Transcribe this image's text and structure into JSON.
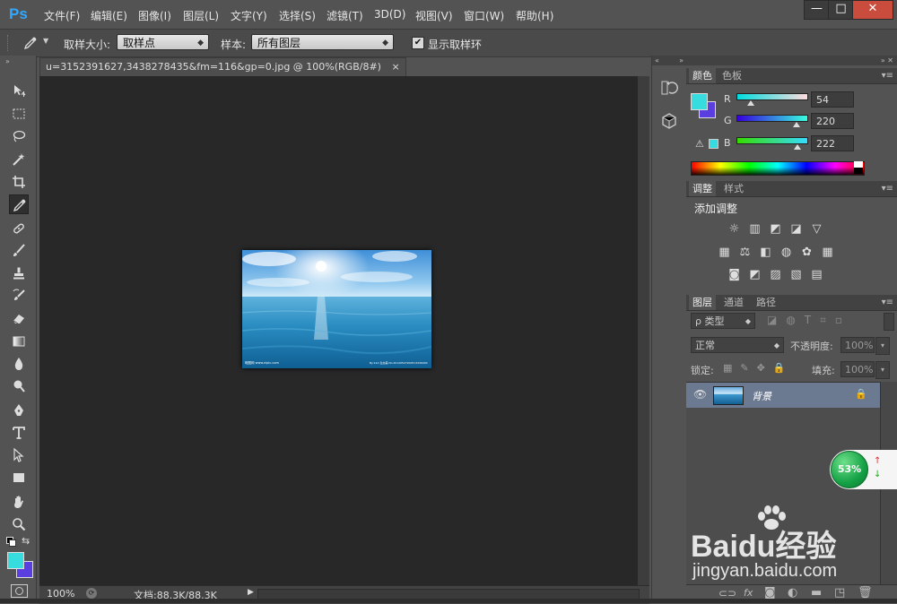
{
  "app": {
    "logo": "Ps"
  },
  "menu": [
    "文件(F)",
    "编辑(E)",
    "图像(I)",
    "图层(L)",
    "文字(Y)",
    "选择(S)",
    "滤镜(T)",
    "3D(D)",
    "视图(V)",
    "窗口(W)",
    "帮助(H)"
  ],
  "window_controls": {
    "minimize": "—",
    "maximize": "□",
    "close": "✕"
  },
  "options": {
    "sample_size_label": "取样大小:",
    "sample_size_value": "取样点",
    "sample_label": "样本:",
    "sample_value": "所有图层",
    "show_ring_label": "显示取样环",
    "show_ring_checked": true
  },
  "document": {
    "tab_title": "u=3152391627,3438278435&fm=116&gp=0.jpg @ 100%(RGB/8#)",
    "close": "×",
    "zoom": "100%",
    "doc_info": "文档:88.3K/88.3K",
    "image_watermark_left": "昵图网 www.nipic.com",
    "image_watermark_right": "By:12A 生态美 No.20120527200513436000"
  },
  "color_panel": {
    "tabs": [
      "颜色",
      "色板"
    ],
    "r_label": "R",
    "g_label": "G",
    "b_label": "B",
    "r_value": "54",
    "g_value": "220",
    "b_value": "222",
    "foreground_color": "#36dcde",
    "background_color": "#5a3ee0",
    "r_fraction": 0.21,
    "g_fraction": 0.86,
    "b_fraction": 0.87
  },
  "adjustments_panel": {
    "tabs": [
      "调整",
      "样式"
    ],
    "title": "添加调整"
  },
  "layers_panel": {
    "tabs": [
      "图层",
      "通道",
      "路径"
    ],
    "filter_kind": "ρ 类型",
    "blend_mode": "正常",
    "opacity_label": "不透明度:",
    "opacity_value": "100%",
    "lock_label": "锁定:",
    "fill_label": "填充:",
    "fill_value": "100%",
    "layers": [
      {
        "name": "背景",
        "visible": true,
        "locked": true
      }
    ]
  },
  "overlay": {
    "progress_badge": "53%",
    "watermark_brand": "Baidu经验",
    "watermark_url": "jingyan.baidu.com"
  }
}
